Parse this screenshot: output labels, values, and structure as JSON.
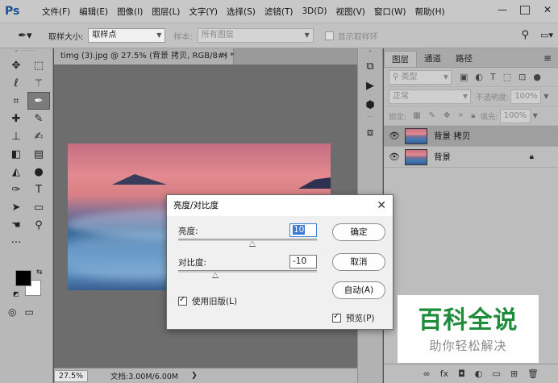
{
  "app": {
    "logo": "Ps"
  },
  "menu": [
    "文件(F)",
    "编辑(E)",
    "图像(I)",
    "图层(L)",
    "文字(Y)",
    "选择(S)",
    "滤镜(T)",
    "3D(D)",
    "视图(V)",
    "窗口(W)",
    "帮助(H)"
  ],
  "options": {
    "sample_size_label": "取样大小:",
    "sample_size_value": "取样点",
    "sample_label": "样本:",
    "sample_value": "所有图层",
    "show_ring_label": "显示取样环"
  },
  "document": {
    "tab_title": "timg (3).jpg @ 27.5% (背景 拷贝, RGB/8#) *",
    "zoom": "27.5%",
    "info": "文档:3.00M/6.00M"
  },
  "layers_panel": {
    "tabs": [
      "图层",
      "通道",
      "路径"
    ],
    "filter_label": "类型",
    "blend_mode": "正常",
    "opacity_label": "不透明度:",
    "opacity_value": "100%",
    "lock_label": "锁定:",
    "fill_label": "填充:",
    "fill_value": "100%",
    "layers": [
      {
        "name": "背景 拷贝"
      },
      {
        "name": "背景"
      }
    ]
  },
  "dialog": {
    "title": "亮度/对比度",
    "brightness_label": "亮度:",
    "brightness_value": "10",
    "contrast_label": "对比度:",
    "contrast_value": "-10",
    "brightness_slider": {
      "value": 10,
      "min": -150,
      "max": 150
    },
    "contrast_slider": {
      "value": -10,
      "min": -50,
      "max": 100
    },
    "ok_label": "确定",
    "cancel_label": "取消",
    "auto_label": "自动(A)",
    "legacy_label": "使用旧版(L)",
    "preview_label": "预览(P)"
  },
  "watermark": {
    "title": "百科全说",
    "subtitle": "助你轻松解决"
  }
}
